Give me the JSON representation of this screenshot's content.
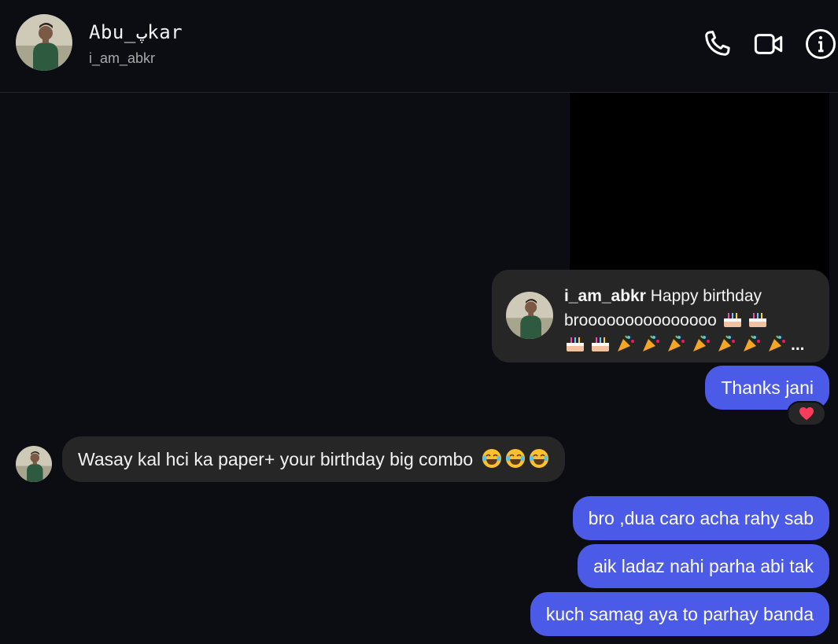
{
  "header": {
    "name": "Abu_ﭖkar",
    "username": "i_am_abkr",
    "icons": [
      "phone-icon",
      "video-call-icon",
      "info-icon"
    ]
  },
  "story_reply": {
    "username": "i_am_abkr",
    "text_line1": "Happy birthday",
    "text_line2": "brooooooooooooooo",
    "trailing": "..."
  },
  "messages": {
    "thanks": "Thanks jani",
    "reaction": "heart",
    "incoming": "Wasay kal hci ka paper+ your birthday big combo",
    "out1": "bro ,dua caro acha rahy sab",
    "out2": "aik ladaz nahi parha abi tak",
    "out3": "kuch samag aya to parhay banda"
  },
  "colors": {
    "background": "#0c0d12",
    "outgoing_bubble": "#4c5ae8",
    "incoming_bubble": "#262626",
    "heart": "#ff3b5c"
  }
}
